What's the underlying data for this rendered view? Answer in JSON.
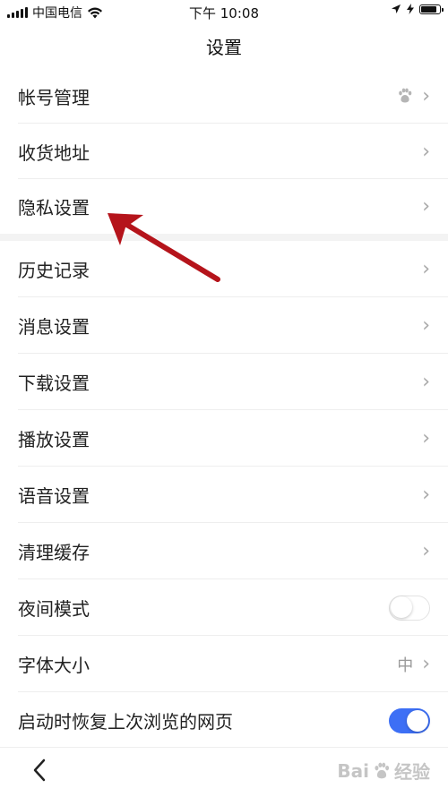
{
  "status_bar": {
    "carrier": "中国电信",
    "time": "下午 10:08"
  },
  "header": {
    "title": "设置"
  },
  "groups": [
    {
      "items": [
        {
          "label": "帐号管理",
          "right": "paw-icon"
        },
        {
          "label": "收货地址"
        },
        {
          "label": "隐私设置"
        }
      ]
    },
    {
      "items": [
        {
          "label": "历史记录"
        },
        {
          "label": "消息设置"
        },
        {
          "label": "下载设置"
        },
        {
          "label": "播放设置"
        },
        {
          "label": "语音设置"
        },
        {
          "label": "清理缓存"
        },
        {
          "label": "夜间模式",
          "toggle": false
        },
        {
          "label": "字体大小",
          "value": "中"
        },
        {
          "label": "启动时恢复上次浏览的网页",
          "toggle": true
        }
      ]
    }
  ],
  "colors": {
    "toggle_on": "#3d6ff5",
    "annotation_arrow": "#b5141b"
  },
  "watermark": {
    "text": "Bai",
    "suffix": "经验"
  }
}
